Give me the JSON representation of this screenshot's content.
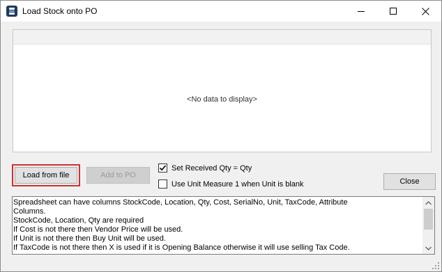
{
  "window": {
    "title": "Load Stock onto PO",
    "app_icon": "app-logo-icon",
    "controls": [
      "minimize-icon",
      "maximize-icon",
      "close-icon"
    ]
  },
  "grid": {
    "empty_text": "<No data to display>"
  },
  "buttons": {
    "load_from_file": "Load from file",
    "add_to_po": "Add to PO",
    "close": "Close"
  },
  "options": {
    "set_received_qty": {
      "label": "Set Received Qty = Qty",
      "checked": true
    },
    "use_unit_measure": {
      "label": "Use Unit Measure 1 when Unit is blank",
      "checked": false
    }
  },
  "notes": {
    "lines": [
      "Spreadsheet can have columns StockCode, Location, Qty, Cost, SerialNo, Unit, TaxCode, Attribute",
      "Columns.",
      "StockCode, Location, Qty are required",
      "If Cost is not there then Vendor Price will be used.",
      "If Unit is not there then Buy Unit will be used.",
      "If TaxCode is not there then X is used if it is Opening Balance otherwise it will use selling Tax Code."
    ]
  },
  "colors": {
    "highlight": "#d32f2f",
    "window_bg": "#f0f0f0"
  }
}
